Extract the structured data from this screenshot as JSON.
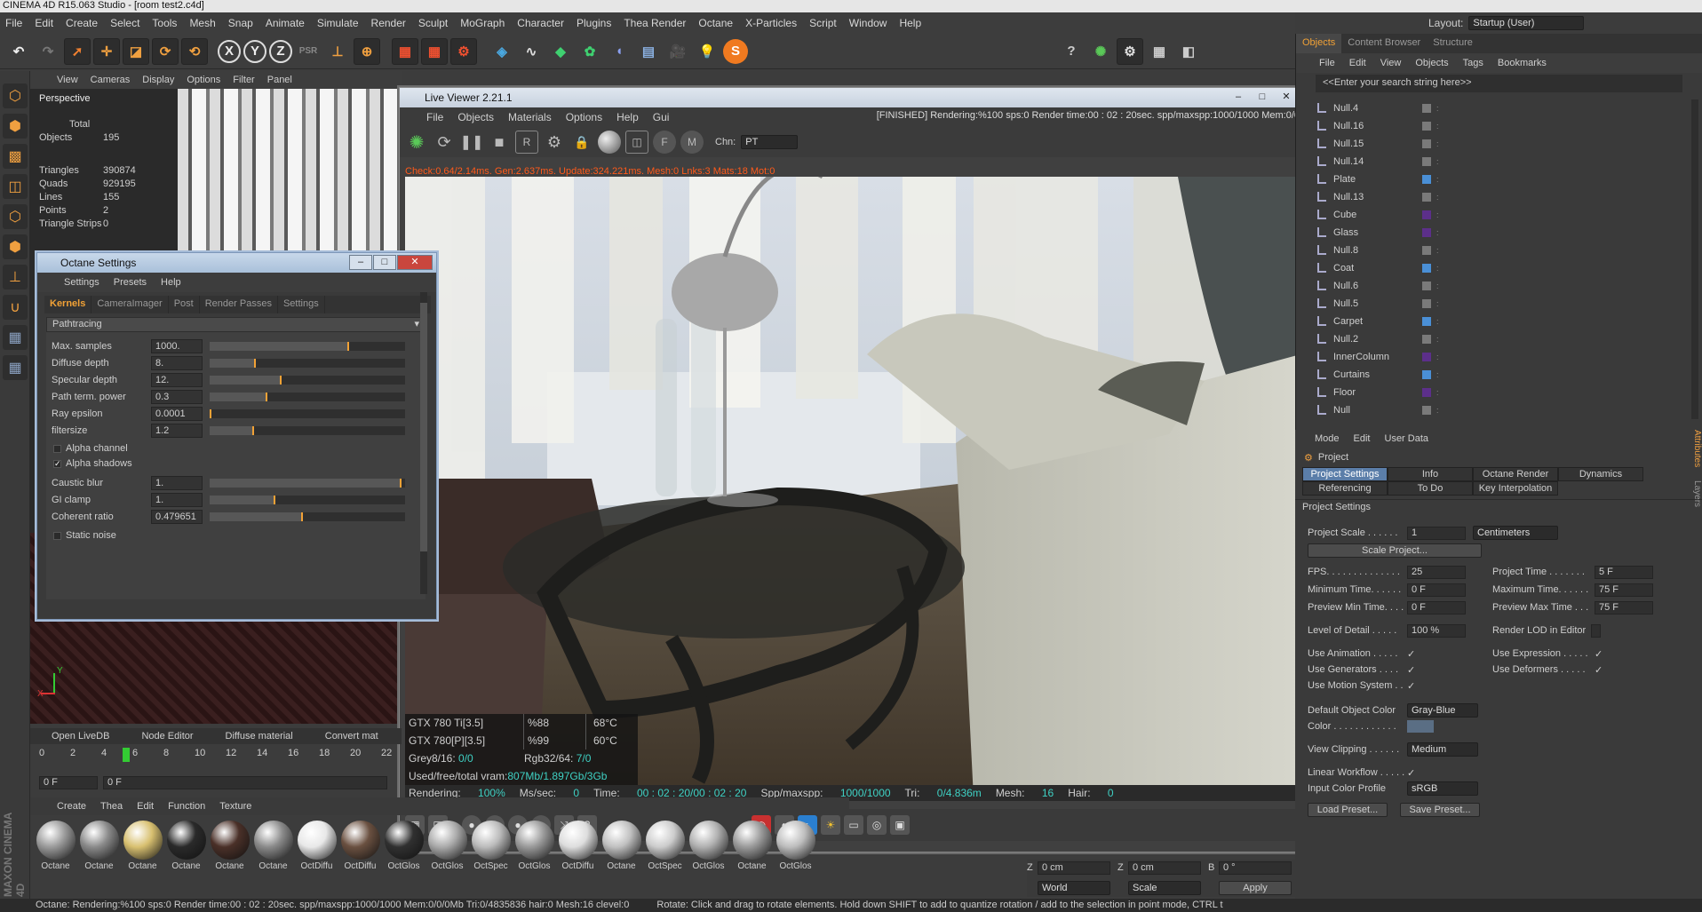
{
  "app": {
    "title": "CINEMA 4D R15.063 Studio - [room test2.c4d]",
    "layout_label": "Layout:",
    "layout_value": "Startup (User)"
  },
  "menu": [
    "File",
    "Edit",
    "Create",
    "Select",
    "Tools",
    "Mesh",
    "Snap",
    "Animate",
    "Simulate",
    "Render",
    "Sculpt",
    "MoGraph",
    "Character",
    "Plugins",
    "Thea Render",
    "Octane",
    "X-Particles",
    "Script",
    "Window",
    "Help"
  ],
  "toolbar": {
    "axes": [
      "X",
      "Y",
      "Z"
    ],
    "psr": "PSR"
  },
  "viewport": {
    "menu": [
      "View",
      "Cameras",
      "Display",
      "Options",
      "Filter",
      "Panel"
    ],
    "label": "Perspective",
    "total": "Total",
    "stats": [
      [
        "Objects",
        "195"
      ],
      [
        "Triangles",
        "390874"
      ],
      [
        "Quads",
        "929195"
      ],
      [
        "Lines",
        "155"
      ],
      [
        "Points",
        "2"
      ],
      [
        "Triangle Strips",
        "0"
      ]
    ]
  },
  "octane_settings": {
    "title": "Octane Settings",
    "menu": [
      "Settings",
      "Presets",
      "Help"
    ],
    "tabs": [
      "Kernels",
      "CameraImager",
      "Post",
      "Render Passes",
      "Settings"
    ],
    "kernel": "Pathtracing",
    "rows": [
      {
        "label": "Max. samples",
        "value": "1000.",
        "fill": 0.72
      },
      {
        "label": "Diffuse depth",
        "value": "8.",
        "fill": 0.24
      },
      {
        "label": "Specular depth",
        "value": "12.",
        "fill": 0.37
      },
      {
        "label": "Path term. power",
        "value": "0.3",
        "fill": 0.3
      },
      {
        "label": "Ray epsilon",
        "value": "0.0001",
        "fill": 0.0
      },
      {
        "label": "filtersize",
        "value": "1.2",
        "fill": 0.23
      }
    ],
    "checks": [
      {
        "label": "Alpha channel",
        "checked": false
      },
      {
        "label": "Alpha shadows",
        "checked": true
      }
    ],
    "rows2": [
      {
        "label": "Caustic blur",
        "value": "1.",
        "fill": 0.99
      },
      {
        "label": "GI clamp",
        "value": "1.",
        "fill": 0.34
      },
      {
        "label": "Coherent ratio",
        "value": "0.479651",
        "fill": 0.48
      }
    ],
    "static_noise": "Static noise"
  },
  "live_viewer": {
    "title": "Live Viewer 2.21.1",
    "menu": [
      "File",
      "Objects",
      "Materials",
      "Options",
      "Help",
      "Gui"
    ],
    "status": "[FINISHED]  Rendering:%100 sps:0 Render time:00 : 02 : 20sec. spp/maxspp:1000/1000 Mem:0/0",
    "chn_label": "Chn:",
    "chn_value": "PT",
    "diag": "Check:0.64/2.14ms. Gen:2.637ms. Update:324.221ms. Mesh:0 Lnks:3 Mats:18 Mot:0",
    "gpus": [
      [
        "GTX 780 Ti[3.5]",
        "%88",
        "68°C"
      ],
      [
        "GTX 780[P][3.5]",
        "%99",
        "60°C"
      ]
    ],
    "grey": "Grey8/16: ",
    "grey_val": "0/0",
    "rgb": "Rgb32/64: ",
    "rgb_val": "7/0",
    "vram_label": "Used/free/total vram: ",
    "vram_val": "807Mb/1.897Gb/3Gb",
    "stats": [
      [
        "Rendering: ",
        "100%"
      ],
      [
        "Ms/sec: ",
        "0"
      ],
      [
        "Time: ",
        "00 : 02 : 20/00 : 02 : 20"
      ],
      [
        "Spp/maxspp: ",
        "1000/1000"
      ],
      [
        "Tri: ",
        "0/4.836m"
      ],
      [
        "Mesh: ",
        "16"
      ],
      [
        "Hair: ",
        "0"
      ]
    ]
  },
  "objects_panel": {
    "tabs": [
      "Objects",
      "Content Browser",
      "Structure"
    ],
    "menu": [
      "File",
      "Edit",
      "View",
      "Objects",
      "Tags",
      "Bookmarks"
    ],
    "search": "<<Enter your search string here>>",
    "items": [
      {
        "name": "Null.4",
        "color": "#7a7a7a"
      },
      {
        "name": "Null.16",
        "color": "#7a7a7a"
      },
      {
        "name": "Null.15",
        "color": "#7a7a7a"
      },
      {
        "name": "Null.14",
        "color": "#7a7a7a"
      },
      {
        "name": "Plate",
        "color": "#4a8fd6"
      },
      {
        "name": "Null.13",
        "color": "#7a7a7a"
      },
      {
        "name": "Cube",
        "color": "#5c2f8a"
      },
      {
        "name": "Glass",
        "color": "#5c2f8a"
      },
      {
        "name": "Null.8",
        "color": "#7a7a7a"
      },
      {
        "name": "Coat",
        "color": "#4a8fd6"
      },
      {
        "name": "Null.6",
        "color": "#7a7a7a"
      },
      {
        "name": "Null.5",
        "color": "#7a7a7a"
      },
      {
        "name": "Carpet",
        "color": "#4a8fd6"
      },
      {
        "name": "Null.2",
        "color": "#7a7a7a"
      },
      {
        "name": "InnerColumn",
        "color": "#5c2f8a"
      },
      {
        "name": "Curtains",
        "color": "#4a8fd6"
      },
      {
        "name": "Floor",
        "color": "#5c2f8a"
      },
      {
        "name": "Null",
        "color": "#7a7a7a"
      }
    ]
  },
  "attributes": {
    "menu": [
      "Mode",
      "Edit",
      "User Data"
    ],
    "section": "Project",
    "tabs": [
      "Project Settings",
      "Info",
      "Octane Render",
      "Dynamics",
      "Referencing",
      "To Do",
      "Key Interpolation"
    ],
    "header": "Project Settings",
    "project_scale_label": "Project Scale . . . . . .",
    "project_scale": "1",
    "units": "Centimeters",
    "scale_btn": "Scale Project...",
    "fps_label": "FPS. . . . . . . . . . . . . .",
    "fps": "25",
    "project_time_label": "Project Time . . . . . . .",
    "project_time": "5 F",
    "min_time_label": "Minimum Time. . . . . .",
    "min_time": "0 F",
    "max_time_label": "Maximum Time. . . . . .",
    "max_time": "75 F",
    "prev_min_label": "Preview Min Time. . . .",
    "prev_min": "0 F",
    "prev_max_label": "Preview Max Time . . .",
    "prev_max": "75 F",
    "lod_label": "Level of Detail . . . . .",
    "lod": "100 %",
    "render_lod": "Render LOD in Editor",
    "use_anim": "Use Animation . . . . .",
    "use_expr": "Use Expression . . . . .",
    "use_gen": "Use Generators . . . .",
    "use_def": "Use Deformers . . . . .",
    "use_motion": "Use Motion System . .",
    "obj_color_label": "Default Object Color",
    "obj_color": "Gray-Blue",
    "color_label": "Color . . . . . . . . . . . .",
    "clip_label": "View Clipping . . . . . .",
    "clip": "Medium",
    "linear_label": "Linear Workflow . . . . .",
    "icp_label": "Input Color Profile",
    "icp": "sRGB",
    "load": "Load Preset...",
    "save": "Save Preset..."
  },
  "timeline": {
    "ticks": [
      "0",
      "2",
      "4",
      "6",
      "8",
      "10",
      "12",
      "14",
      "16",
      "18",
      "20",
      "22"
    ],
    "frame": "0 F",
    "frame2": "0 F"
  },
  "bottom_tabs": [
    "Open LiveDB",
    "Node Editor",
    "Diffuse material",
    "Convert mat"
  ],
  "materials": {
    "menu": [
      "Create",
      "Thea",
      "Edit",
      "Function",
      "Texture"
    ],
    "items": [
      {
        "name": "Octane",
        "color": "#9a9a9a"
      },
      {
        "name": "Octane",
        "color": "#8a8a8a"
      },
      {
        "name": "Octane",
        "color": "#d8c070"
      },
      {
        "name": "Octane",
        "color": "#2a2a2a"
      },
      {
        "name": "Octane",
        "color": "#4a3028"
      },
      {
        "name": "Octane",
        "color": "#8a8a8a"
      },
      {
        "name": "OctDiffu",
        "color": "#e8e8e8"
      },
      {
        "name": "OctDiffu",
        "color": "#6a5040"
      },
      {
        "name": "OctGlos",
        "color": "#303030"
      },
      {
        "name": "OctGlos",
        "color": "#aaaaaa"
      },
      {
        "name": "OctSpec",
        "color": "#bbbbbb"
      },
      {
        "name": "OctGlos",
        "color": "#999999"
      },
      {
        "name": "OctDiffu",
        "color": "#dddddd"
      },
      {
        "name": "Octane",
        "color": "#c0c0c0"
      },
      {
        "name": "OctSpec",
        "color": "#cccccc"
      },
      {
        "name": "OctGlos",
        "color": "#b0b0b0"
      },
      {
        "name": "Octane",
        "color": "#9a9a9a"
      },
      {
        "name": "OctGlos",
        "color": "#bdbdbd"
      }
    ]
  },
  "coords": {
    "z1_label": "Z",
    "z1": "0 cm",
    "z2_label": "Z",
    "z2": "0 cm",
    "b_label": "B",
    "b": "0 °",
    "world": "World",
    "scale": "Scale",
    "apply": "Apply"
  },
  "statusbar": "Octane: Rendering:%100 sps:0 Render time:00 : 02 : 20sec. spp/maxspp:1000/1000 Mem:0/0/0Mb Tri:0/4835836 hair:0 Mesh:16 clevel:0",
  "statusbar2": "Rotate: Click and drag to rotate elements. Hold down SHIFT to add to quantize rotation / add to the selection in point mode, CTRL t",
  "side_tabs": [
    "Attributes",
    "Layers"
  ]
}
